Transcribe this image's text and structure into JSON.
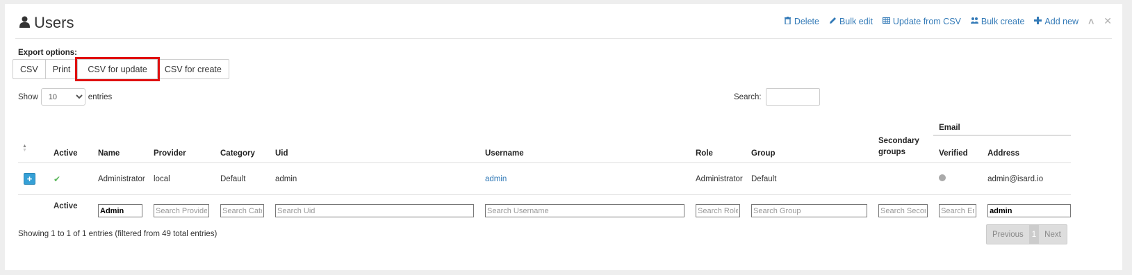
{
  "header": {
    "title": "Users",
    "actions": {
      "delete": "Delete",
      "bulk_edit": "Bulk edit",
      "update_csv": "Update from CSV",
      "bulk_create": "Bulk create",
      "add_new": "Add new"
    }
  },
  "export": {
    "label": "Export options:",
    "buttons": [
      "CSV",
      "Print",
      "CSV for update",
      "CSV for create"
    ]
  },
  "length": {
    "show": "Show",
    "value": "10",
    "entries": "entries"
  },
  "search": {
    "label": "Search:"
  },
  "table": {
    "group_header": "Email",
    "columns": [
      "Active",
      "Name",
      "Provider",
      "Category",
      "Uid",
      "Username",
      "Role",
      "Group",
      "Secondary groups",
      "Verified",
      "Address"
    ],
    "rows": [
      {
        "name": "Administrator",
        "provider": "local",
        "category": "Default",
        "uid": "admin",
        "username": "admin",
        "role": "Administrator",
        "group": "Default",
        "secondary": "",
        "address": "admin@isard.io"
      }
    ],
    "filters": {
      "active_label": "Active",
      "name_value": "Admin",
      "provider_ph": "Search Provider",
      "category_ph": "Search Category",
      "uid_ph": "Search Uid",
      "username_ph": "Search Username",
      "role_ph": "Search Role",
      "group_ph": "Search Group",
      "secondary_ph": "Search Secondary groups",
      "verified_ph": "Search Email verified",
      "address_value": "admin"
    }
  },
  "footer": {
    "info": "Showing 1 to 1 of 1 entries (filtered from 49 total entries)",
    "prev": "Previous",
    "page": "1",
    "next": "Next"
  },
  "icons": {
    "title": "user-icon",
    "delete": "trash-icon",
    "bulk_edit": "pencil-icon",
    "update_csv": "table-icon",
    "bulk_create": "users-icon",
    "add_new": "plus-icon",
    "collapse": "chevron-up-icon",
    "close": "close-icon"
  },
  "colors": {
    "link": "#337ab7",
    "highlight": "#e01010",
    "expand": "#35a0d6",
    "check": "#5cb85c"
  }
}
